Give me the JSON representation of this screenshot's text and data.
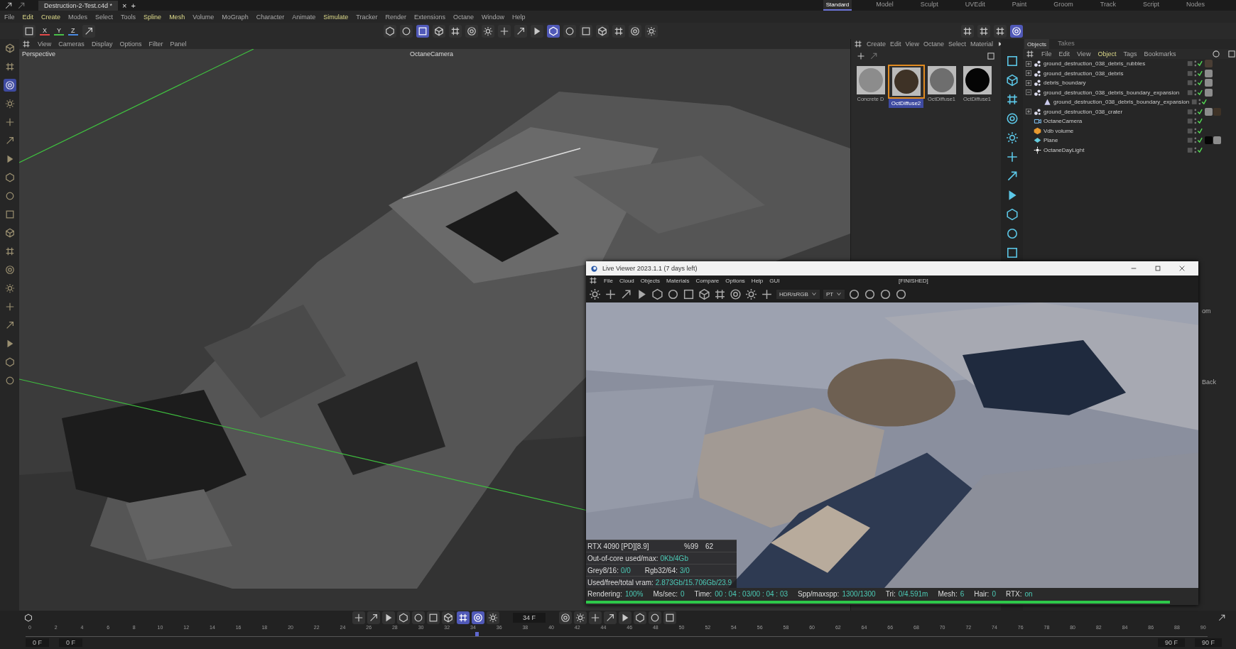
{
  "title_bar": {
    "document_tab": "Destruction-2-Test.c4d *",
    "close": "×",
    "new_tab": "+"
  },
  "layouts": [
    {
      "label": "Standard",
      "selected": true
    },
    {
      "label": "Model",
      "selected": false
    },
    {
      "label": "Sculpt",
      "selected": false
    },
    {
      "label": "UVEdit",
      "selected": false
    },
    {
      "label": "Paint",
      "selected": false
    },
    {
      "label": "Groom",
      "selected": false
    },
    {
      "label": "Track",
      "selected": false
    },
    {
      "label": "Script",
      "selected": false
    },
    {
      "label": "Nodes",
      "selected": false
    }
  ],
  "menu": [
    {
      "label": "File",
      "highlighted": false
    },
    {
      "label": "Edit",
      "highlighted": true
    },
    {
      "label": "Create",
      "highlighted": true
    },
    {
      "label": "Modes",
      "highlighted": false
    },
    {
      "label": "Select",
      "highlighted": false
    },
    {
      "label": "Tools",
      "highlighted": false
    },
    {
      "label": "Spline",
      "highlighted": true
    },
    {
      "label": "Mesh",
      "highlighted": true
    },
    {
      "label": "Volume",
      "highlighted": false
    },
    {
      "label": "MoGraph",
      "highlighted": false
    },
    {
      "label": "Character",
      "highlighted": false
    },
    {
      "label": "Animate",
      "highlighted": false
    },
    {
      "label": "Simulate",
      "highlighted": true
    },
    {
      "label": "Tracker",
      "highlighted": false
    },
    {
      "label": "Render",
      "highlighted": false
    },
    {
      "label": "Extensions",
      "highlighted": false
    },
    {
      "label": "Octane",
      "highlighted": false
    },
    {
      "label": "Window",
      "highlighted": false
    },
    {
      "label": "Help",
      "highlighted": false
    }
  ],
  "axis_buttons": [
    {
      "label": "X",
      "color": "#e04848"
    },
    {
      "label": "Y",
      "color": "#48c048"
    },
    {
      "label": "Z",
      "color": "#4888e0"
    }
  ],
  "main_toolbar": [
    {
      "active": false
    },
    {
      "active": false
    },
    {
      "active": true
    },
    {
      "active": false
    },
    {
      "active": false
    },
    {
      "active": false
    },
    {
      "active": false
    },
    {
      "active": false
    },
    {
      "active": false
    },
    {
      "active": false
    },
    {
      "active": true
    },
    {
      "active": false
    },
    {
      "active": false
    },
    {
      "active": false
    },
    {
      "active": false
    },
    {
      "active": false
    },
    {
      "active": false
    }
  ],
  "render_toolbar": [
    {
      "active": false
    },
    {
      "active": false
    },
    {
      "active": false
    },
    {
      "active": true
    }
  ],
  "tools": [
    {
      "active": false
    },
    {
      "active": false
    },
    {
      "active": true
    },
    {
      "active": false
    },
    {
      "active": false
    },
    {
      "active": false
    },
    {
      "active": false
    },
    {
      "active": false
    },
    {
      "active": false
    },
    {
      "active": false
    },
    {
      "active": false
    },
    {
      "active": false
    },
    {
      "active": false
    },
    {
      "active": false
    },
    {
      "active": false
    },
    {
      "active": false
    },
    {
      "active": false
    },
    {
      "active": false
    },
    {
      "active": false
    }
  ],
  "viewport": {
    "menu": [
      "View",
      "Cameras",
      "Display",
      "Options",
      "Filter",
      "Panel"
    ],
    "name": "Perspective",
    "camera": "OctaneCamera"
  },
  "materials": {
    "menu": [
      "Create",
      "Edit",
      "View",
      "Octane",
      "Select",
      "Material"
    ],
    "items": [
      {
        "name": "Concrete D",
        "selected": false,
        "color": "#8c8c8c"
      },
      {
        "name": "OctDiffuse2",
        "selected": true,
        "color": "#3e3226"
      },
      {
        "name": "OctDiffuse1",
        "selected": false,
        "color": "#6e6e6e"
      },
      {
        "name": "OctDiffuse1",
        "selected": false,
        "color": "#050505"
      }
    ]
  },
  "objects": {
    "tabs": [
      {
        "label": "Objects",
        "selected": true
      },
      {
        "label": "Takes",
        "selected": false
      }
    ],
    "menu": [
      {
        "label": "File",
        "highlighted": false
      },
      {
        "label": "Edit",
        "highlighted": false
      },
      {
        "label": "View",
        "highlighted": false
      },
      {
        "label": "Object",
        "highlighted": true
      },
      {
        "label": "Tags",
        "highlighted": false
      },
      {
        "label": "Bookmarks",
        "highlighted": false
      }
    ],
    "tree": [
      {
        "name": "ground_destruction_038_debris_rubbles",
        "kind": "group",
        "expanded": false,
        "tags": [
          {
            "color": "#4a3e34"
          }
        ]
      },
      {
        "name": "ground_destruction_038_debris",
        "kind": "group",
        "expanded": false,
        "tags": [
          {
            "color": "#8c8c8c"
          }
        ]
      },
      {
        "name": "debris_boundary",
        "kind": "group",
        "expanded": false,
        "tags": [
          {
            "color": "#8c8c8c"
          }
        ]
      },
      {
        "name": "ground_destruction_038_debris_boundary_expansion",
        "kind": "group",
        "expanded": true,
        "tags": [
          {
            "color": "#8c8c8c"
          }
        ],
        "children": [
          {
            "name": "ground_destruction_038_debris_boundary_expansion",
            "kind": "mesh"
          }
        ]
      },
      {
        "name": "ground_destruction_038_crater",
        "kind": "group",
        "expanded": false,
        "tags": [
          {
            "color": "#8c8c8c"
          },
          {
            "color": "#3e3226"
          }
        ]
      },
      {
        "name": "OctaneCamera",
        "kind": "camera"
      },
      {
        "name": "Vdb volume",
        "kind": "volume"
      },
      {
        "name": "Plane",
        "kind": "plane",
        "tags": [
          {
            "color": "#050505"
          },
          {
            "color": "#8c8c8c"
          }
        ]
      },
      {
        "name": "OctaneDayLight",
        "kind": "light"
      }
    ]
  },
  "attributes": {
    "texts": [
      "om",
      "Back"
    ]
  },
  "live_viewer": {
    "title": "Live Viewer 2023.1.1 (7 days left)",
    "menu": [
      "File",
      "Cloud",
      "Objects",
      "Materials",
      "Compare",
      "Options",
      "Help",
      "GUI"
    ],
    "status": "[FINISHED]",
    "selects": [
      "HDR/sRGB",
      "PT"
    ],
    "stats": {
      "device": "RTX 4090 [PD][8.9]",
      "percent": "%99",
      "column_3": "62",
      "rows": [
        [
          {
            "label": "Out-of-core used/max:",
            "value": "0Kb/4Gb"
          }
        ],
        [
          {
            "label": "Grey8/16:",
            "value": "0/0"
          },
          {
            "label": "Rgb32/64:",
            "value": "3/0"
          }
        ],
        [
          {
            "label": "Used/free/total vram:",
            "value": "2.873Gb/15.706Gb/23.9"
          }
        ]
      ]
    },
    "status_bar": [
      {
        "label": "Rendering:",
        "value": "100%"
      },
      {
        "label": "Ms/sec:",
        "value": "0"
      },
      {
        "label": "Time:",
        "value": "00 : 04 : 03/00 : 04 : 03"
      },
      {
        "label": "Spp/maxspp:",
        "value": "1300/1300"
      },
      {
        "label": "Tri:",
        "value": "0/4.591m"
      },
      {
        "label": "Mesh:",
        "value": "6"
      },
      {
        "label": "Hair:",
        "value": "0"
      },
      {
        "label": "RTX:",
        "value": "on"
      }
    ],
    "progress": {
      "level": 1
    }
  },
  "timeline": {
    "frame": "34 F",
    "buttons": [
      {
        "active": false
      },
      {
        "active": false
      },
      {
        "active": false
      },
      {
        "active": false
      },
      {
        "active": false
      },
      {
        "active": false
      },
      {
        "active": false
      },
      {
        "active": true
      },
      {
        "active": true
      },
      {
        "active": false
      }
    ],
    "ticks": [
      "0",
      "2",
      "4",
      "6",
      "8",
      "10",
      "12",
      "14",
      "16",
      "18",
      "20",
      "22",
      "24",
      "26",
      "28",
      "30",
      "32",
      "34",
      "36",
      "38",
      "40",
      "42",
      "44",
      "46",
      "48",
      "50",
      "52",
      "54",
      "56",
      "58",
      "60",
      "62",
      "64",
      "66",
      "68",
      "70",
      "72",
      "74",
      "76",
      "78",
      "80",
      "82",
      "84",
      "86",
      "88",
      "90"
    ],
    "slider": {
      "level": 0.378
    },
    "start_fields": [
      "0 F",
      "0 F"
    ],
    "end_fields": [
      "90 F",
      "90 F"
    ]
  }
}
